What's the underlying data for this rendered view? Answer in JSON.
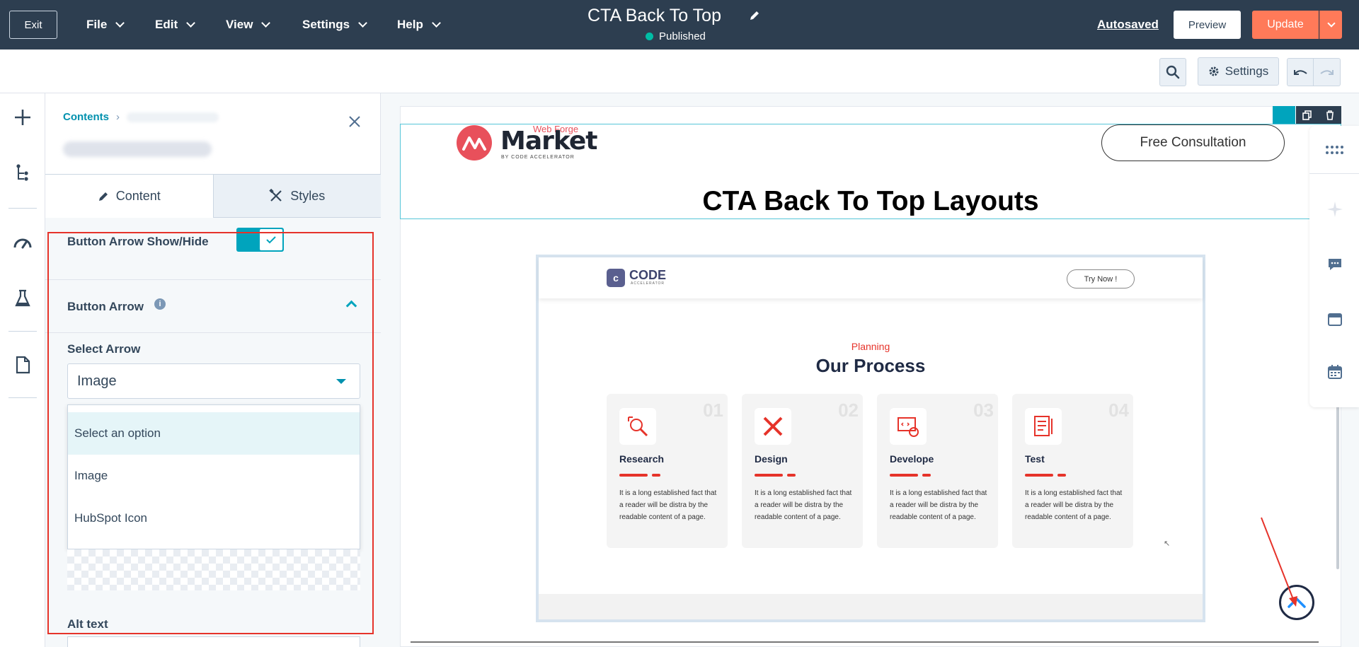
{
  "topbar": {
    "exit_label": "Exit",
    "menus": [
      {
        "label": "File"
      },
      {
        "label": "Edit"
      },
      {
        "label": "View"
      },
      {
        "label": "Settings"
      },
      {
        "label": "Help"
      }
    ],
    "page_title": "CTA Back To Top",
    "status": "Published",
    "autosaved": "Autosaved",
    "preview": "Preview",
    "update": "Update"
  },
  "toolbar": {
    "settings_label": "Settings"
  },
  "panel": {
    "breadcrumb": "Contents",
    "tabs": [
      {
        "label": "Content",
        "icon": "pencil-icon"
      },
      {
        "label": "Styles",
        "icon": "brush-icon"
      }
    ],
    "arrow_toggle_label": "Button Arrow Show/Hide",
    "arrow_toggle_on": true,
    "arrow_section_label": "Button Arrow",
    "select_arrow_label": "Select Arrow",
    "select_value": "Image",
    "options": [
      "Select an option",
      "Image",
      "HubSpot Icon"
    ],
    "alt_text_label": "Alt text"
  },
  "preview": {
    "logo_top": "Web Forge",
    "logo_main": "Market",
    "logo_sub": "BY CODE ACCELERATOR",
    "consult_button": "Free Consultation",
    "heading": "CTA Back To Top Layouts",
    "screenshot": {
      "brand": "CODE",
      "brand_sub": "ACCELERATOR",
      "try_button": "Try Now !",
      "eyebrow": "Planning",
      "title": "Our Process",
      "cards": [
        {
          "num": "01",
          "title": "Research",
          "text": "It is a long established fact that a reader will be distra by the readable content of a page."
        },
        {
          "num": "02",
          "title": "Design",
          "text": "It is a long established fact that a reader will be distra by the readable content of a page."
        },
        {
          "num": "03",
          "title": "Develope",
          "text": "It is a long established fact that a reader will be distra by the readable content of a page."
        },
        {
          "num": "04",
          "title": "Test",
          "text": "It is a long established fact that a reader will be distra by the readable content of a page."
        }
      ]
    }
  },
  "colors": {
    "topbar": "#2d3e50",
    "accent": "#00a4bd",
    "update": "#ff7a59",
    "highlight": "#e6332a"
  }
}
